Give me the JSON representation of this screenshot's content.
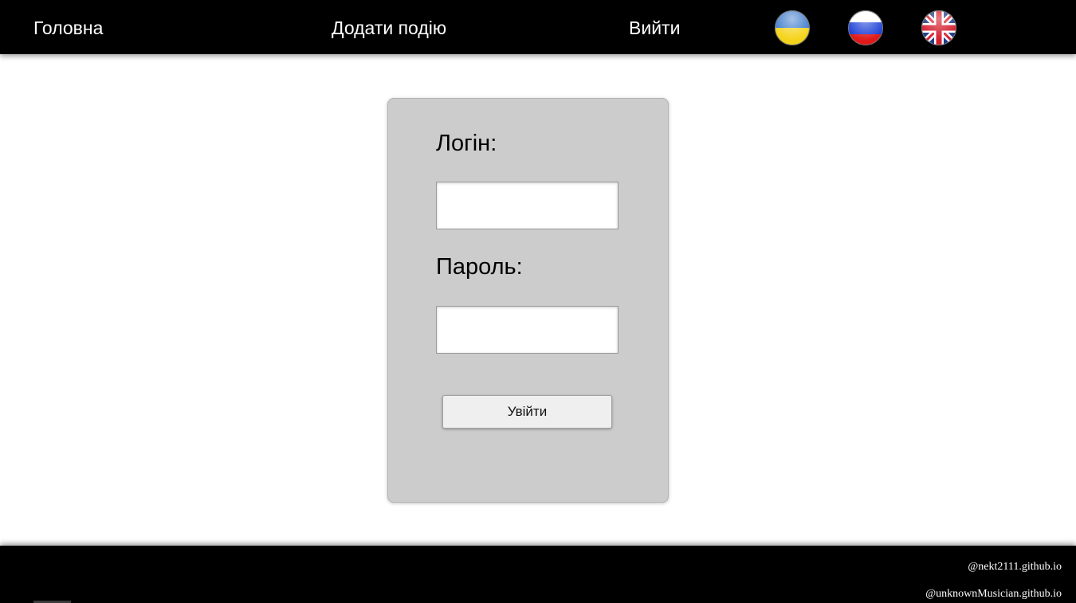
{
  "navbar": {
    "links": {
      "home": "Головна",
      "add_event": "Додати подію",
      "logout": "Вийти"
    },
    "languages": [
      {
        "icon": "ukraine-flag-icon",
        "colors": [
          "#0057b7",
          "#ffd700"
        ]
      },
      {
        "icon": "russia-flag-icon",
        "colors": [
          "#ffffff",
          "#0039a6",
          "#d52b1e"
        ]
      },
      {
        "icon": "uk-flag-icon",
        "colors": [
          "#012169",
          "#ffffff",
          "#c8102e"
        ]
      }
    ]
  },
  "login_form": {
    "login_label": "Логін:",
    "login_value": "",
    "password_label": "Пароль:",
    "password_value": "",
    "submit_label": "Увійти"
  },
  "footer": {
    "links": [
      "@nekt2111.github.io",
      "@unknownMusician.github.io"
    ]
  },
  "colors": {
    "nav_background": "#000000",
    "card_background": "#cccccc",
    "page_background": "#ffffff"
  }
}
